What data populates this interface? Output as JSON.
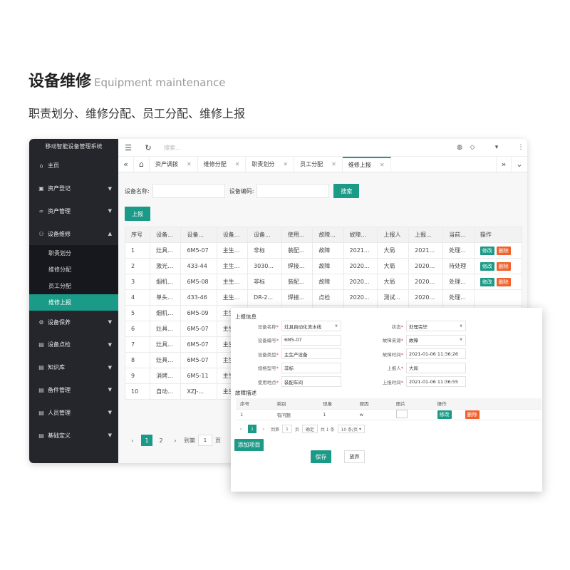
{
  "hero": {
    "title_cn": "设备维修",
    "title_en": "Equipment maintenance",
    "subtitle": "职责划分、维修分配、员工分配、维修上报"
  },
  "app": {
    "brand": "移动智能设备管理系统",
    "accent": "#1a9a87",
    "danger": "#f1612d"
  },
  "sidebar": {
    "items": [
      {
        "label": "主页",
        "icon": "home-icon"
      },
      {
        "label": "资产登记",
        "icon": "register-icon"
      },
      {
        "label": "资产管理",
        "icon": "link-icon"
      },
      {
        "label": "设备维修",
        "icon": "user-icon"
      },
      {
        "label": "设备保养",
        "icon": "gear-icon"
      },
      {
        "label": "设备点检",
        "icon": "check-icon"
      },
      {
        "label": "知识库",
        "icon": "book-icon"
      },
      {
        "label": "备件管理",
        "icon": "parts-icon"
      },
      {
        "label": "人员管理",
        "icon": "people-icon"
      },
      {
        "label": "基础定义",
        "icon": "settings-icon"
      }
    ],
    "sub_items": [
      "职责划分",
      "维修分配",
      "员工分配",
      "维修上报"
    ]
  },
  "topbar": {
    "search_placeholder": "搜索..."
  },
  "tabs": [
    "资产调拨",
    "维修分配",
    "职责划分",
    "员工分配",
    "维修上报"
  ],
  "filter": {
    "name_label": "设备名称:",
    "code_label": "设备编码:",
    "search_btn": "搜索"
  },
  "report_btn": "上报",
  "table": {
    "headers": [
      "序号",
      "设备...",
      "设备...",
      "设备...",
      "设备...",
      "使用...",
      "故障...",
      "故障...",
      "上报人",
      "上报...",
      "当前...",
      "操作"
    ],
    "rows": [
      [
        "1",
        "灶具...",
        "6M5-07",
        "主生...",
        "非标",
        "装配...",
        "故障",
        "2021...",
        "大局",
        "2021...",
        "处理..."
      ],
      [
        "2",
        "激光...",
        "433-44",
        "主生...",
        "3030...",
        "焊接...",
        "故障",
        "2020...",
        "大局",
        "2020...",
        "待处理"
      ],
      [
        "3",
        "烟机...",
        "6M5-08",
        "主生...",
        "非标",
        "装配...",
        "故障",
        "2020...",
        "大局",
        "2020...",
        "处理..."
      ],
      [
        "4",
        "单头...",
        "433-46",
        "主生...",
        "DR-2...",
        "焊接...",
        "点检",
        "2020...",
        "测试...",
        "2020...",
        "处理..."
      ],
      [
        "5",
        "烟机...",
        "6M5-09",
        "主生",
        "",
        "",
        "",
        "",
        "",
        "",
        ""
      ],
      [
        "6",
        "灶具...",
        "6M5-07",
        "主生",
        "",
        "",
        "",
        "",
        "",
        "",
        ""
      ],
      [
        "7",
        "灶具...",
        "6M5-07",
        "主生",
        "",
        "",
        "",
        "",
        "",
        "",
        ""
      ],
      [
        "8",
        "灶具...",
        "6M5-07",
        "主生",
        "",
        "",
        "",
        "",
        "",
        "",
        ""
      ],
      [
        "9",
        "消烤...",
        "6M5-11",
        "主生",
        "",
        "",
        "",
        "",
        "",
        "",
        ""
      ],
      [
        "10",
        "自动...",
        "XZJ-...",
        "主生",
        "",
        "",
        "",
        "",
        "",
        "",
        ""
      ]
    ],
    "edit_label": "修改",
    "delete_label": "删除"
  },
  "pager": {
    "current": "1",
    "next": "2",
    "goto_label": "到第",
    "goto_value": "1",
    "page_unit": "页"
  },
  "form": {
    "section_report": "上报信息",
    "section_fault": "故障描述",
    "left_fields": [
      {
        "label": "设备名称",
        "value": "灶具自动化流水线"
      },
      {
        "label": "设备编号",
        "value": "6M5-07"
      },
      {
        "label": "设备类型",
        "value": "主生产设备"
      },
      {
        "label": "规格型号",
        "value": "非标"
      },
      {
        "label": "使用地点",
        "value": "装配车间"
      }
    ],
    "right_fields": [
      {
        "label": "状态",
        "value": "处理完毕"
      },
      {
        "label": "故障来源",
        "value": "故障"
      },
      {
        "label": "故障时间",
        "value": "2021-01-06 11:36:26"
      },
      {
        "label": "上报人",
        "value": "大局"
      },
      {
        "label": "上报时间",
        "value": "2021-01-06 11:36:55"
      }
    ],
    "fault_headers": [
      "序号",
      "类别",
      "现象",
      "原因",
      "图片",
      "操作"
    ],
    "fault_row": [
      "1",
      "有问题",
      "1",
      "w"
    ],
    "pager": {
      "current": "1",
      "goto_label": "到第",
      "goto_value": "1",
      "page_unit": "页",
      "confirm": "确定",
      "total": "共 1 条",
      "per_page": "10 条/页"
    },
    "add_btn": "添加项目",
    "save_btn": "保存",
    "cancel_btn": "放弃"
  }
}
